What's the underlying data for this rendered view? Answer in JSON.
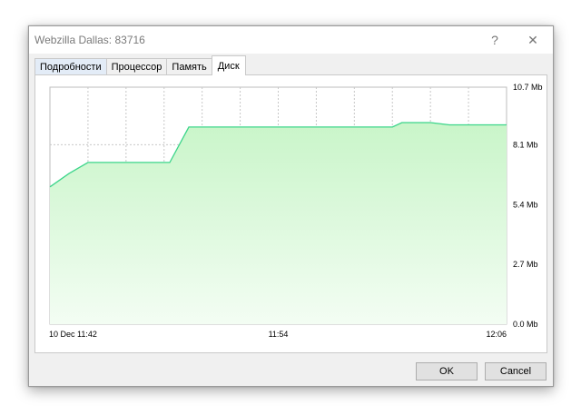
{
  "window": {
    "title": "Webzilla Dallas: 83716",
    "help_label": "?",
    "close_label": "✕"
  },
  "tabs": [
    {
      "label": "Подробности",
      "active": false
    },
    {
      "label": "Процессор",
      "active": false
    },
    {
      "label": "Память",
      "active": false
    },
    {
      "label": "Диск",
      "active": true
    }
  ],
  "buttons": {
    "ok": "OK",
    "cancel": "Cancel"
  },
  "chart_data": {
    "type": "area",
    "y_tick_labels": [
      "10.7 Mb",
      "8.1 Mb",
      "5.4 Mb",
      "2.7 Mb",
      "0.0 Mb"
    ],
    "y_tick_values": [
      10.7,
      8.1,
      5.4,
      2.7,
      0.0
    ],
    "x_tick_labels": [
      "10 Dec 11:42",
      "11:54",
      "12:06"
    ],
    "x_tick_minutes": [
      0,
      12,
      24
    ],
    "ylim": [
      0,
      10.7
    ],
    "xlim_minutes": [
      0,
      24
    ],
    "grid": true,
    "line_color": "#3cd58a",
    "fill_color_top": "#c9f5c9",
    "fill_color_bottom": "#f3fdf3",
    "series": [
      {
        "x_minutes": [
          0,
          1.0,
          2.0,
          3.0,
          4.0,
          5.0,
          6.3,
          7.3,
          8.0,
          10.0,
          12.0,
          14.0,
          16.0,
          18.0,
          18.5,
          19.0,
          20.0,
          21.0,
          22.0,
          23.0,
          24.0
        ],
        "values": [
          6.2,
          6.8,
          7.3,
          7.3,
          7.3,
          7.3,
          7.3,
          8.9,
          8.9,
          8.9,
          8.9,
          8.9,
          8.9,
          8.9,
          9.1,
          9.1,
          9.1,
          9.0,
          9.0,
          9.0,
          9.0
        ]
      }
    ]
  }
}
